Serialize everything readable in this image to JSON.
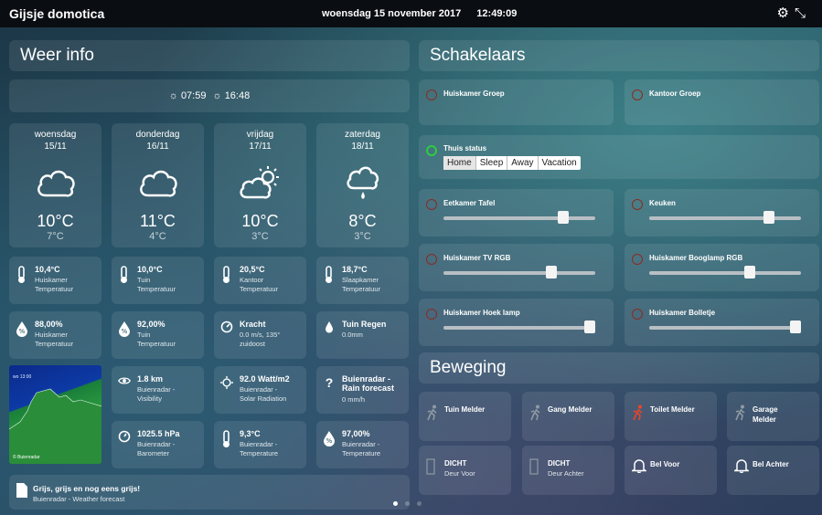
{
  "header": {
    "title": "Gijsje domotica",
    "date": "woensdag 15 november 2017",
    "time": "12:49:09"
  },
  "weather": {
    "title": "Weer info",
    "sunrise": "07:59",
    "sunset": "16:48",
    "days": [
      {
        "name": "woensdag",
        "date": "15/11",
        "high": "10°C",
        "low": "7°C",
        "icon": "cloud-icon"
      },
      {
        "name": "donderdag",
        "date": "16/11",
        "high": "11°C",
        "low": "4°C",
        "icon": "cloud-icon"
      },
      {
        "name": "vrijdag",
        "date": "17/11",
        "high": "10°C",
        "low": "3°C",
        "icon": "partly-sunny-icon"
      },
      {
        "name": "zaterdag",
        "date": "18/11",
        "high": "8°C",
        "low": "3°C",
        "icon": "rain-cloud-icon"
      }
    ],
    "tiles": [
      {
        "value": "10,4°C",
        "line1": "Huiskamer",
        "line2": "Temperatuur",
        "icon": "thermometer-icon"
      },
      {
        "value": "10,0°C",
        "line1": "Tuin",
        "line2": "Temperatuur",
        "icon": "thermometer-icon"
      },
      {
        "value": "20,5°C",
        "line1": "Kantoor",
        "line2": "Temperatuur",
        "icon": "thermometer-icon"
      },
      {
        "value": "18,7°C",
        "line1": "Slaapkamer",
        "line2": "Temperatuur",
        "icon": "thermometer-icon"
      },
      {
        "value": "88,00%",
        "line1": "Huiskamer",
        "line2": "Temperatuur",
        "icon": "humidity-icon"
      },
      {
        "value": "92,00%",
        "line1": "Tuin",
        "line2": "Temperatuur",
        "icon": "humidity-icon"
      },
      {
        "value": "Kracht",
        "line1": "0.0 m/s, 135°",
        "line2": "zuidoost",
        "icon": "compass-icon"
      },
      {
        "value": "Tuin Regen",
        "line1": "0.0mm",
        "line2": "",
        "icon": "raindrop-icon"
      },
      {
        "value": "1.8 km",
        "line1": "Buienradar -",
        "line2": "Visibility",
        "icon": "eye-icon"
      },
      {
        "value": "92.0 Watt/m2",
        "line1": "Buienradar -",
        "line2": "Solar Radiation",
        "icon": "sun-outline-icon"
      },
      {
        "value": "Buienradar - Rain forecast",
        "line1": "0 mm/h",
        "line2": "",
        "icon": "question-icon"
      },
      {
        "value": "1025.5 hPa",
        "line1": "Buienradar -",
        "line2": "Barometer",
        "icon": "gauge-icon"
      },
      {
        "value": "9,3°C",
        "line1": "Buienradar -",
        "line2": "Temperature",
        "icon": "thermometer-icon"
      },
      {
        "value": "97,00%",
        "line1": "Buienradar -",
        "line2": "Temperature",
        "icon": "humidity-icon"
      }
    ],
    "map": {
      "time_label": "wo 13:00",
      "footer": "© Buienradar"
    },
    "forecast": {
      "title": "Grijs, grijs en nog eens grijs!",
      "subtitle": "Buienradar - Weather forecast"
    }
  },
  "switches": {
    "title": "Schakelaars",
    "items": [
      {
        "label": "Huiskamer Groep",
        "status": "off"
      },
      {
        "label": "Kantoor Groep",
        "status": "off"
      },
      {
        "label": "Thuis status",
        "status": "on",
        "options": [
          "Home",
          "Sleep",
          "Away",
          "Vacation"
        ],
        "selected": "Home"
      },
      {
        "label": "Eetkamer Tafel",
        "status": "off",
        "level": 0.79
      },
      {
        "label": "Keuken",
        "status": "off",
        "level": 0.79
      },
      {
        "label": "Huiskamer TV RGB",
        "status": "off",
        "level": 0.71
      },
      {
        "label": "Huiskamer Booglamp RGB",
        "status": "off",
        "level": 0.66
      },
      {
        "label": "Huiskamer Hoek lamp",
        "status": "off",
        "level": 1.0
      },
      {
        "label": "Huiskamer Bolletje",
        "status": "off",
        "level": 1.0
      }
    ]
  },
  "motion": {
    "title": "Beweging",
    "items": [
      {
        "label": "Tuin Melder",
        "sub": "",
        "icon": "walking-person-icon",
        "active": false
      },
      {
        "label": "Gang Melder",
        "sub": "",
        "icon": "walking-person-icon",
        "active": false
      },
      {
        "label": "Toilet Melder",
        "sub": "",
        "icon": "walking-person-icon",
        "active": true
      },
      {
        "label": "Garage Melder",
        "sub": "",
        "icon": "walking-person-icon",
        "active": false
      },
      {
        "label": "DICHT",
        "sub": "Deur Voor",
        "icon": "door-icon",
        "active": false
      },
      {
        "label": "DICHT",
        "sub": "Deur Achter",
        "icon": "door-icon",
        "active": false
      },
      {
        "label": "Bel Voor",
        "sub": "",
        "icon": "bell-icon",
        "active": false
      },
      {
        "label": "Bel Achter",
        "sub": "",
        "icon": "bell-icon",
        "active": false
      }
    ]
  },
  "pager": {
    "pages": 3,
    "active": 1
  }
}
